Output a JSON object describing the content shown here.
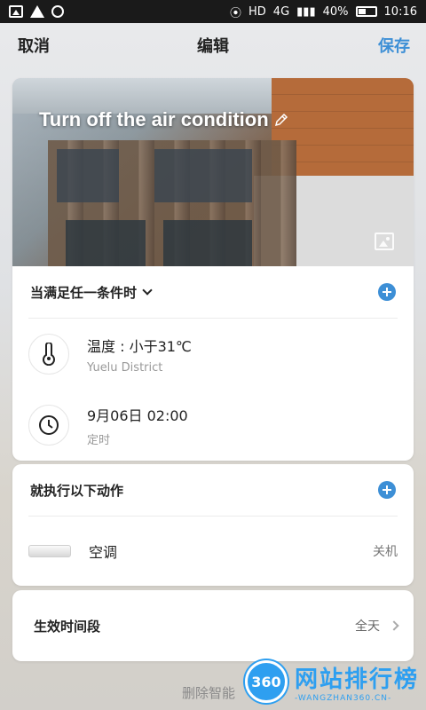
{
  "status_bar": {
    "battery": "40%",
    "time": "10:16",
    "network": "4G",
    "icons": [
      "image-icon",
      "warning-icon",
      "chat-icon",
      "hotspot-icon",
      "hd-icon",
      "signal-icon",
      "battery-icon"
    ]
  },
  "header": {
    "cancel_label": "取消",
    "title": "编辑",
    "save_label": "保存",
    "accent": "#3d8fd6"
  },
  "scene": {
    "title": "Turn off the air condition",
    "icons": [
      "pencil-icon",
      "image-icon"
    ]
  },
  "conditions": {
    "header_label": "当满足任一条件时",
    "items": [
      {
        "icon": "thermometer-icon",
        "title": "温度 : 小于31℃",
        "subtitle": "Yuelu District"
      },
      {
        "icon": "clock-icon",
        "title": "9月06日 02:00",
        "subtitle": "定时"
      }
    ]
  },
  "actions": {
    "header_label": "就执行以下动作",
    "items": [
      {
        "icon": "air-conditioner-icon",
        "name": "空调",
        "state": "关机"
      }
    ]
  },
  "effective_time": {
    "label": "生效时间段",
    "value": "全天"
  },
  "footer": {
    "delete_label": "删除智能"
  },
  "watermark": {
    "logo_text": "360",
    "title": "网站排行榜",
    "url": "-WANGZHAN360.CN-"
  }
}
